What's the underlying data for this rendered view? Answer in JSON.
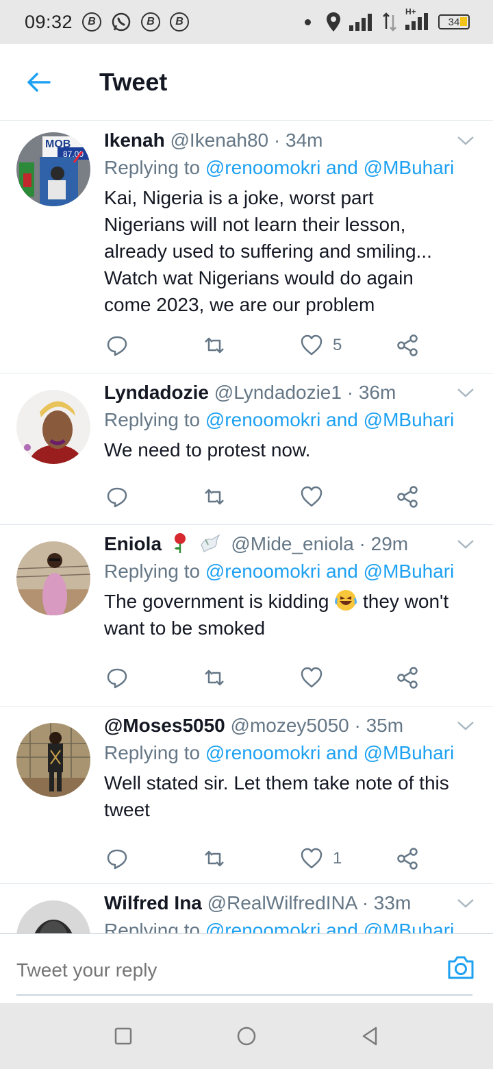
{
  "status_bar": {
    "time": "09:32",
    "app_icons": [
      "B",
      "whatsapp",
      "B",
      "B"
    ],
    "battery": "34",
    "network": "H+"
  },
  "header": {
    "title": "Tweet"
  },
  "tweets": [
    {
      "name": "Ikenah",
      "handle": "@Ikenah80 · 34m",
      "replying_prefix": "Replying to ",
      "mention1": "@renoomokri",
      "and": " and ",
      "mention2": "@MBuhari",
      "text_lines": [
        "Kai, Nigeria is a joke, worst part",
        "Nigerians will not learn their lesson,",
        "already used to suffering and smiling...",
        "Watch wat Nigerians would do again",
        "come 2023, we are our problem"
      ],
      "likes": "5"
    },
    {
      "name": "Lyndadozie",
      "handle": "@Lyndadozie1 · 36m",
      "replying_prefix": "Replying to ",
      "mention1": "@renoomokri",
      "and": " and ",
      "mention2": "@MBuhari",
      "text_lines": [
        "We need to protest now."
      ],
      "likes": ""
    },
    {
      "name": "Eniola",
      "handle": "@Mide_eniola · 29m",
      "replying_prefix": "Replying to ",
      "mention1": "@renoomokri",
      "and": " and ",
      "mention2": "@MBuhari",
      "text_line1_a": "The government is kidding ",
      "text_line1_b": " they won't",
      "text_line2": "want to be smoked",
      "likes": ""
    },
    {
      "name": "@Moses5050",
      "handle": "@mozey5050 · 35m",
      "replying_prefix": "Replying to ",
      "mention1": "@renoomokri",
      "and": " and ",
      "mention2": "@MBuhari",
      "text_lines": [
        "Well stated sir. Let them take note of this",
        "tweet"
      ],
      "likes": "1"
    },
    {
      "name": "Wilfred Ina",
      "handle": "@RealWilfredINA · 33m",
      "replying_prefix": "Replying to ",
      "mention1": "@renoomokri",
      "and": " and ",
      "mention2": "@MBuhari"
    }
  ],
  "reply_bar": {
    "placeholder": "Tweet your reply"
  },
  "colors": {
    "accent": "#1da1f2",
    "secondary_text": "#657786",
    "divider": "#e1e8ed"
  }
}
